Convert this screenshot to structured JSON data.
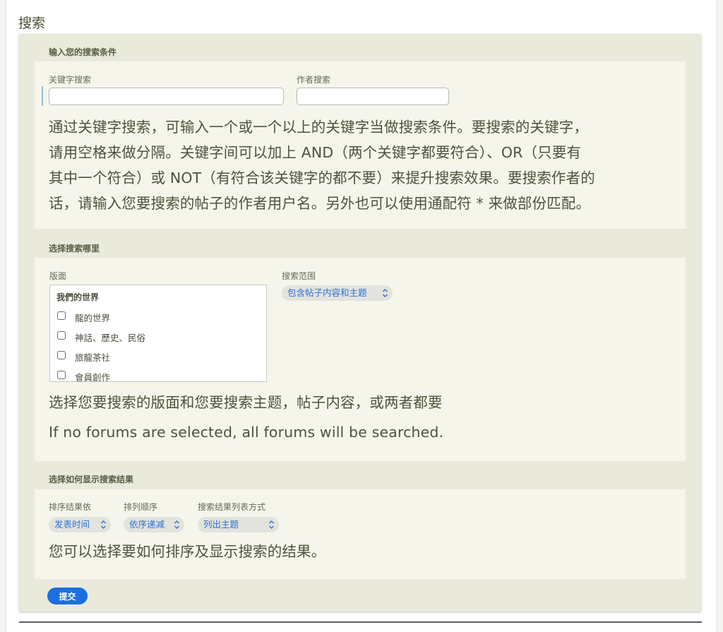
{
  "page": {
    "title": "搜索"
  },
  "search_conditions": {
    "heading": "输入您的搜索条件",
    "keyword_label": "关键字搜索",
    "keyword_value": "",
    "author_label": "作者搜索",
    "author_value": "",
    "description_lines": [
      "通过关键字搜索，可输入一个或一个以上的关键字当做搜索条件。要搜索的关键字，",
      "请用空格来做分隔。关键字间可以加上 AND（两个关键字都要符合）、OR（只要有",
      "其中一个符合）或 NOT（有符合该关键字的都不要）来提升搜索效果。要搜索作者的",
      "话，请输入您要搜索的帖子的作者用户名。另外也可以使用通配符 * 来做部份匹配。"
    ]
  },
  "search_where": {
    "heading": "选择搜索哪里",
    "forums_label": "版面",
    "forum_group": "我們的世界",
    "forums": [
      "龍的世界",
      "神話、歷史、民俗",
      "旅龍茶社",
      "會員創作"
    ],
    "scope_label": "搜索范围",
    "scope_value": "包含帖子内容和主题",
    "description": "选择您要搜索的版面和您要搜索主题，帖子内容，或两者都要",
    "note": "If no forums are selected, all forums will be searched."
  },
  "display_results": {
    "heading": "选择如何显示搜索结果",
    "sort_by_label": "排序结果依",
    "sort_by_value": "发表时间",
    "order_label": "排列顺序",
    "order_value": "依序递减",
    "list_mode_label": "搜索结果列表方式",
    "list_mode_value": "列出主题",
    "description": "您可以选择要如何排序及显示搜索的结果。"
  },
  "submit_label": "提交",
  "colors": {
    "panel_bg": "#e9eadb",
    "box_bg": "#f5f5ec",
    "text": "#4e533b",
    "select_text": "#2f6fd8",
    "button_bg": "#1b6fe0"
  },
  "icons": {
    "select_chevron": "chevron-updown-icon",
    "checkbox": "checkbox-icon"
  }
}
